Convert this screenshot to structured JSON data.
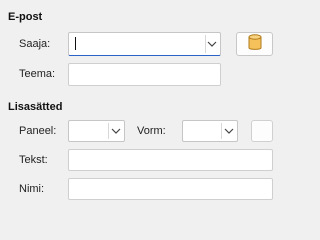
{
  "email": {
    "heading": "E-post",
    "recipient_label": "Saaja:",
    "recipient_value": "",
    "subject_label": "Teema:",
    "subject_value": ""
  },
  "extras": {
    "heading": "Lisasätted",
    "panel_label": "Paneel:",
    "panel_value": "",
    "form_label": "Vorm:",
    "form_value": "",
    "text_label": "Tekst:",
    "text_value": "",
    "name_label": "Nimi:",
    "name_value": ""
  },
  "icons": {
    "address_book": "database-icon",
    "dropdown": "chevron-down-icon"
  },
  "colors": {
    "focus_underline": "#2a64c8",
    "database_icon_fill": "#f5c15a"
  }
}
